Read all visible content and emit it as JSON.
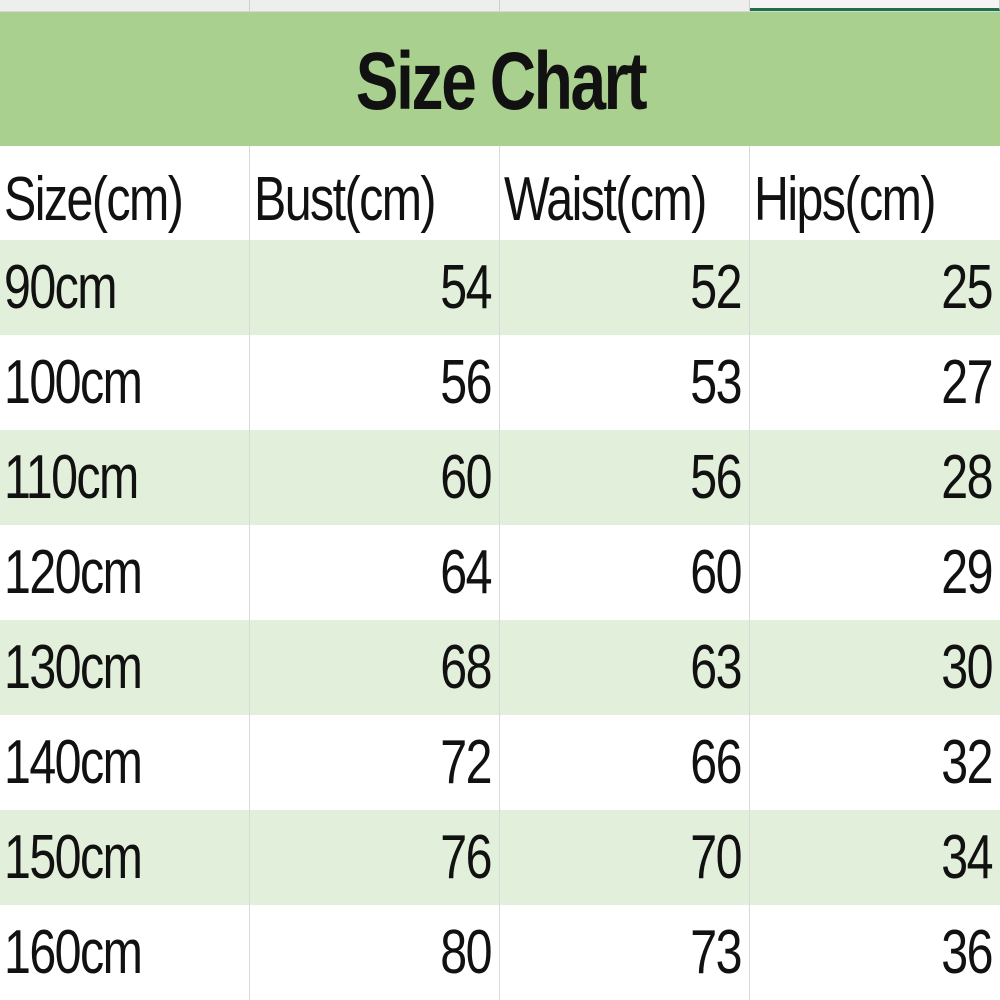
{
  "title": "Size Chart",
  "colors": {
    "title_bg": "#a9d08e",
    "band_bg": "#e2efda",
    "plain_bg": "#ffffff",
    "selection_accent": "#1e7145"
  },
  "table": {
    "headers": [
      "Size(cm)",
      "Bust(cm)",
      "Waist(cm)",
      "Hips(cm)"
    ],
    "rows": [
      [
        "90cm",
        "54",
        "52",
        "25"
      ],
      [
        "100cm",
        "56",
        "53",
        "27"
      ],
      [
        "110cm",
        "60",
        "56",
        "28"
      ],
      [
        "120cm",
        "64",
        "60",
        "29"
      ],
      [
        "130cm",
        "68",
        "63",
        "30"
      ],
      [
        "140cm",
        "72",
        "66",
        "32"
      ],
      [
        "150cm",
        "76",
        "70",
        "34"
      ],
      [
        "160cm",
        "80",
        "73",
        "36"
      ]
    ]
  }
}
